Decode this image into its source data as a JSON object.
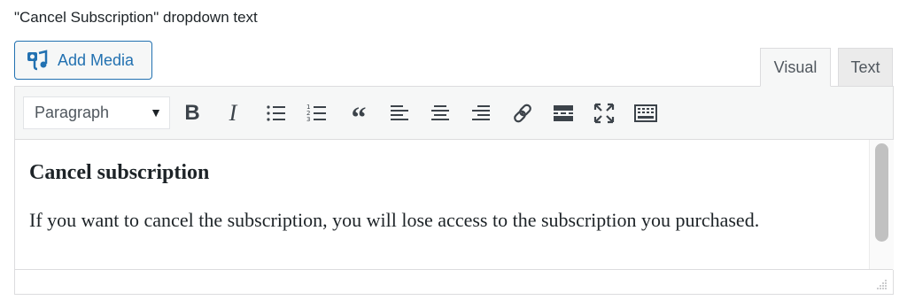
{
  "field": {
    "label": "\"Cancel Subscription\" dropdown text"
  },
  "toolbar_top": {
    "add_media_label": "Add Media",
    "add_media_icon": "add-media-icon"
  },
  "tabs": [
    {
      "label": "Visual",
      "active": true
    },
    {
      "label": "Text",
      "active": false
    }
  ],
  "editor_toolbar": {
    "format_select": {
      "value": "Paragraph",
      "icon": "chevron-down-icon"
    },
    "buttons": [
      {
        "name": "bold",
        "glyph": "B"
      },
      {
        "name": "italic",
        "glyph": "I"
      },
      {
        "name": "bulleted-list",
        "icon": "bulleted-list-icon"
      },
      {
        "name": "numbered-list",
        "icon": "numbered-list-icon"
      },
      {
        "name": "blockquote",
        "glyph": "“"
      },
      {
        "name": "align-left",
        "icon": "align-left-icon"
      },
      {
        "name": "align-center",
        "icon": "align-center-icon"
      },
      {
        "name": "align-right",
        "icon": "align-right-icon"
      },
      {
        "name": "insert-link",
        "icon": "link-icon"
      },
      {
        "name": "read-more",
        "icon": "read-more-icon"
      },
      {
        "name": "fullscreen",
        "icon": "fullscreen-icon"
      },
      {
        "name": "toolbar-toggle",
        "icon": "keyboard-icon"
      }
    ]
  },
  "content": {
    "heading": "Cancel subscription",
    "paragraph": "If you want to cancel the subscription, you will lose access to the subscription you purchased."
  },
  "colors": {
    "accent": "#2271b1",
    "toolbar_bg": "#f6f7f7",
    "border": "#dcdcde",
    "text": "#1d2327"
  }
}
